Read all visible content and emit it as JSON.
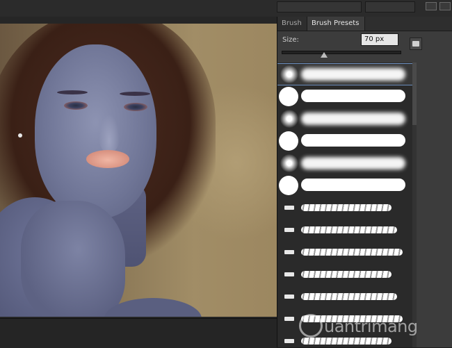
{
  "panel": {
    "tabs": [
      {
        "label": "Brush"
      },
      {
        "label": "Brush Presets"
      }
    ],
    "size": {
      "label": "Size:",
      "value": "70 px",
      "slider_fraction": 0.36
    }
  },
  "presets": [
    {
      "type": "soft-round",
      "selected": true
    },
    {
      "type": "hard-round",
      "selected": false
    },
    {
      "type": "soft-round",
      "selected": false
    },
    {
      "type": "hard-round",
      "selected": false
    },
    {
      "type": "soft-round",
      "selected": false
    },
    {
      "type": "hard-round",
      "selected": false
    },
    {
      "type": "texture",
      "selected": false
    },
    {
      "type": "texture",
      "selected": false
    },
    {
      "type": "texture",
      "selected": false
    },
    {
      "type": "texture",
      "selected": false
    },
    {
      "type": "texture",
      "selected": false
    },
    {
      "type": "texture",
      "selected": false
    },
    {
      "type": "texture",
      "selected": false
    }
  ],
  "icons": {
    "folder": "folder-icon",
    "panel_menu": "menu-icon",
    "watermark_logo": "lightbulb-icon"
  },
  "watermark": {
    "text": "uantrimang"
  },
  "colors": {
    "selection": "#6d8fbf",
    "panel_bg": "#3c3c3c",
    "list_bg": "#2a2a2a"
  }
}
